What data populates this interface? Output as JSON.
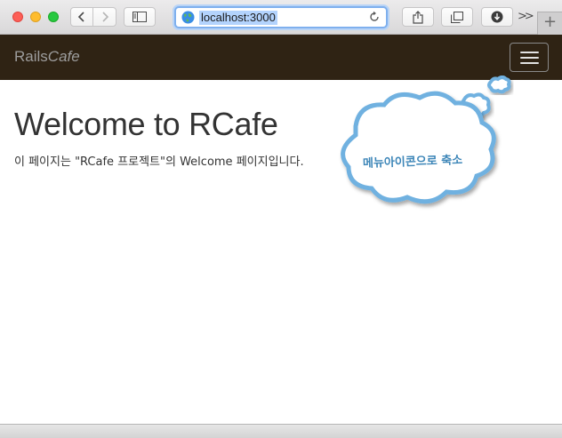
{
  "browser": {
    "url": "localhost:3000",
    "overflow_label": ">>",
    "new_tab_label": "+"
  },
  "navbar": {
    "brand_plain": "Rails",
    "brand_italic": "Cafe"
  },
  "main": {
    "title": "Welcome to RCafe",
    "intro": "이 페이지는 \"RCafe 프로젝트\"의 Welcome 페이지입니다."
  },
  "annotation": {
    "text": "메뉴아이콘으로 축소"
  },
  "colors": {
    "navbar_bg": "#2f2314",
    "bubble_stroke": "#6fb1e0",
    "bubble_text": "#3d86b8"
  }
}
